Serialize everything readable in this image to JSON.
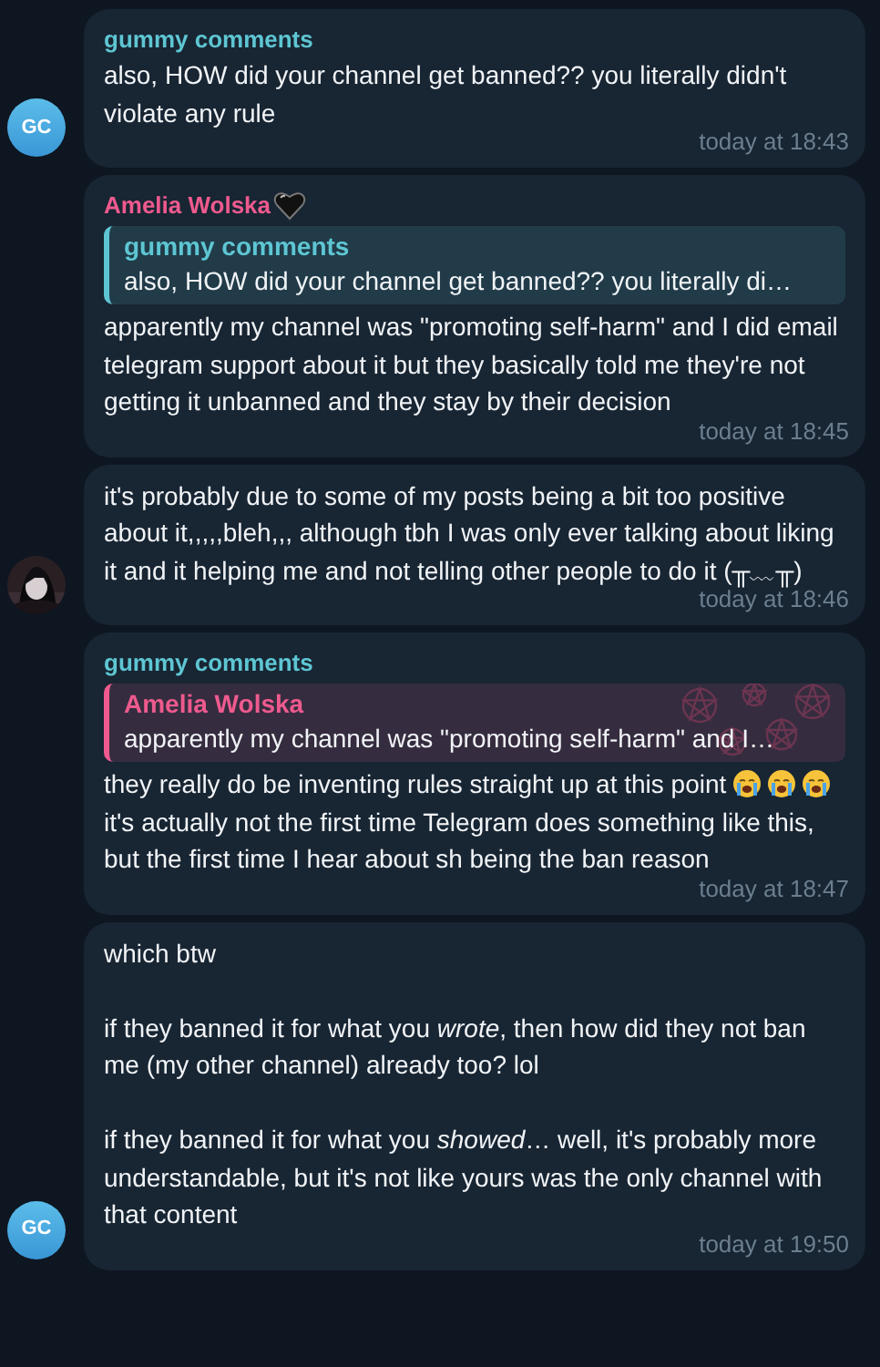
{
  "groups": [
    {
      "avatar": {
        "kind": "initials",
        "text": "GC"
      },
      "messages": [
        {
          "sender": {
            "name": "gummy comments",
            "color": "#5ec6d3"
          },
          "paragraphs": [
            {
              "text": "also, HOW did your channel get banned?? you literally didn't violate any rule"
            }
          ],
          "time": "today at 18:43"
        }
      ]
    },
    {
      "avatar": {
        "kind": "picture"
      },
      "messages": [
        {
          "sender": {
            "name": "Amelia Wolska",
            "color": "#ee5a8e",
            "badge": {
              "kind": "heart"
            }
          },
          "reply": {
            "name": "gummy comments",
            "color": "#5ec6d3",
            "text": "also, HOW did your channel get banned?? you literally di…"
          },
          "paragraphs": [
            {
              "text": "apparently my channel was \"promoting self-harm\" and I did email telegram support about it but they basically told me they're not getting it unbanned and they stay by their decision"
            }
          ],
          "time": "today at 18:45"
        },
        {
          "paragraphs": [
            {
              "text": "it's probably due to some of my posts being a bit too positive about it,,,,,bleh,,, although tbh I was only ever talking about liking it and it helping me and not telling other people to do it (╥﹏╥)"
            }
          ],
          "time": "today at 18:46"
        }
      ]
    },
    {
      "avatar": {
        "kind": "initials",
        "text": "GC"
      },
      "messages": [
        {
          "sender": {
            "name": "gummy comments",
            "color": "#5ec6d3"
          },
          "reply": {
            "name": "Amelia Wolska",
            "color": "#ee5a8e",
            "pattern": true,
            "text": "apparently my channel was \"promoting self-harm\" and I…"
          },
          "paragraphs": [
            {
              "text": "they really do be inventing rules straight up at this point",
              "emojis": [
                {
                  "kind": "crying"
                },
                {
                  "kind": "crying"
                },
                {
                  "kind": "crying"
                }
              ]
            },
            {
              "text": "it's actually not the first time Telegram does something like this, but the first time I hear about sh being the ban reason"
            }
          ],
          "time": "today at 18:47"
        },
        {
          "paragraphs": [
            {
              "text": "which btw"
            },
            {
              "text": "if they banned it for what you *wrote*, then how did they not ban me (my other channel) already too? lol"
            },
            {
              "text": "if they banned it for what you *showed*… well, it's probably more understandable, but it's not like yours was the only channel with that content"
            }
          ],
          "spaced": true,
          "time": "today at 19:50"
        }
      ]
    }
  ]
}
